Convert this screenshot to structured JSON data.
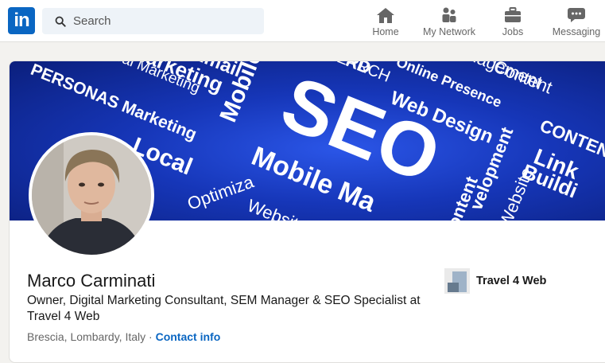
{
  "header": {
    "logo_text": "in",
    "search_placeholder": "Search",
    "nav": [
      {
        "label": "Home",
        "icon": "home-icon"
      },
      {
        "label": "My Network",
        "icon": "network-icon"
      },
      {
        "label": "Jobs",
        "icon": "briefcase-icon"
      },
      {
        "label": "Messaging",
        "icon": "messaging-icon"
      }
    ]
  },
  "profile": {
    "name": "Marco Carminati",
    "headline": "Owner, Digital Marketing Consultant, SEM Manager & SEO Specialist at Travel 4 Web",
    "location": "Brescia, Lombardy, Italy",
    "separator": " · ",
    "contact_link": "Contact info",
    "company": "Travel 4 Web"
  },
  "banner": {
    "words": [
      "SEO",
      "Mobile Ma",
      "Web Design",
      "Online Presence",
      "Management",
      "Content",
      "CONTENT",
      "Link",
      "Buildi",
      "PERSONAS Marketing",
      "Viral Marketing",
      "Mobile",
      "Email",
      "Marketing",
      "SEARCH",
      "Website",
      "Optimiza",
      "Local",
      "velopment",
      "ontent",
      "RD",
      "Website"
    ]
  },
  "colors": {
    "accent": "#0a66c2",
    "banner": "#1a3fd0"
  }
}
